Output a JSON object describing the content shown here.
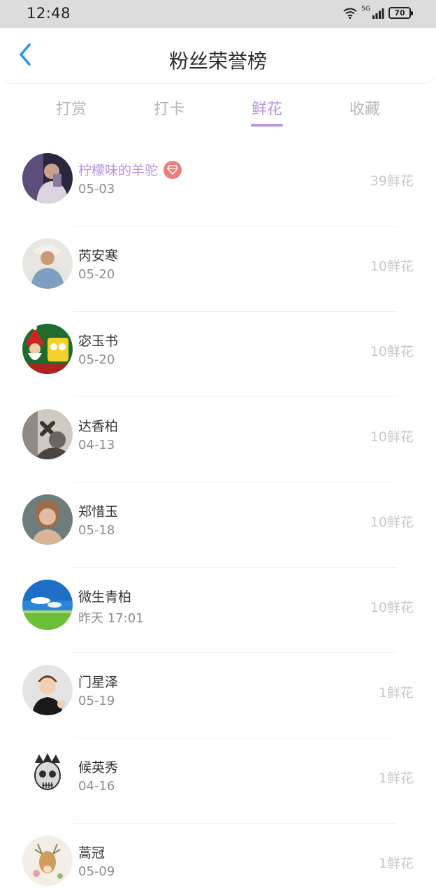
{
  "status_bar": {
    "time": "12:48",
    "network": "5G",
    "battery": "70",
    "icons": [
      "wifi-icon",
      "signal-icon",
      "battery-icon"
    ]
  },
  "header": {
    "back_icon": "chevron-left-icon",
    "title": "粉丝荣誉榜"
  },
  "tabs": [
    {
      "label": "打赏",
      "active": false
    },
    {
      "label": "打卡",
      "active": false
    },
    {
      "label": "鲜花",
      "active": true
    },
    {
      "label": "收藏",
      "active": false
    }
  ],
  "colors": {
    "accent": "#b993e0",
    "back_arrow": "#2196f3",
    "vip_badge": "#f07b7b",
    "muted_text": "#c8c8c8"
  },
  "fans": [
    {
      "name": "柠檬味的羊驼",
      "date": "05-03",
      "flowers": "39鲜花",
      "vip": true,
      "badge_icon": "diamond-icon"
    },
    {
      "name": "芮安寒",
      "date": "05-20",
      "flowers": "10鲜花",
      "vip": false
    },
    {
      "name": "宓玉书",
      "date": "05-20",
      "flowers": "10鲜花",
      "vip": false
    },
    {
      "name": "达香柏",
      "date": "04-13",
      "flowers": "10鲜花",
      "vip": false
    },
    {
      "name": "郑惜玉",
      "date": "05-18",
      "flowers": "10鲜花",
      "vip": false
    },
    {
      "name": "微生青柏",
      "date": "昨天 17:01",
      "flowers": "10鲜花",
      "vip": false
    },
    {
      "name": "门星泽",
      "date": "05-19",
      "flowers": "1鲜花",
      "vip": false
    },
    {
      "name": "候英秀",
      "date": "04-16",
      "flowers": "1鲜花",
      "vip": false
    },
    {
      "name": "蒿冠",
      "date": "05-09",
      "flowers": "1鲜花",
      "vip": false
    }
  ]
}
